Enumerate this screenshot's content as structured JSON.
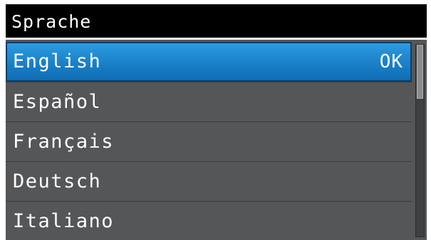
{
  "title": "Sprache",
  "languages": [
    {
      "label": "English",
      "selected": true,
      "badge": "OK"
    },
    {
      "label": "Español",
      "selected": false
    },
    {
      "label": "Français",
      "selected": false
    },
    {
      "label": "Deutsch",
      "selected": false
    },
    {
      "label": "Italiano",
      "selected": false
    }
  ],
  "scroll": {
    "visible_fraction": 0.28,
    "position": 0.0
  },
  "colors": {
    "title_bar": "#000000",
    "list_background": "#555658",
    "selection": "#1a80c8",
    "text": "#ffffff"
  }
}
